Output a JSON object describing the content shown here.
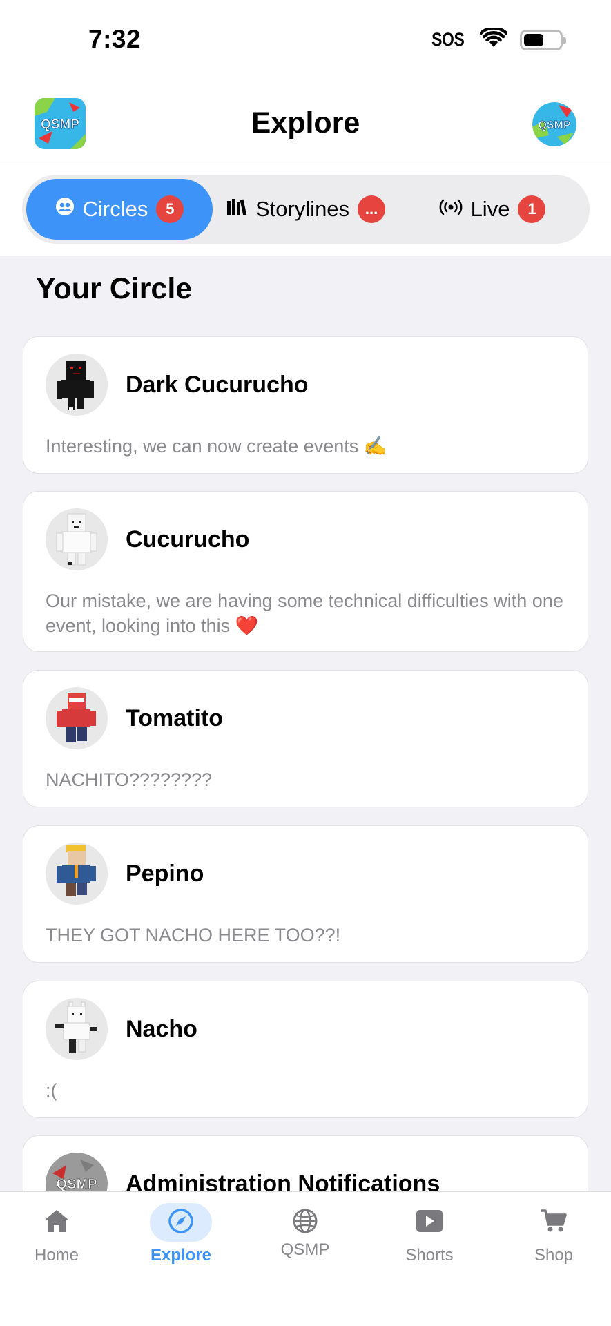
{
  "status_bar": {
    "time": "7:32",
    "sos": "SOS",
    "battery_level": 0.55
  },
  "header": {
    "title": "Explore",
    "logo_text": "QSMP",
    "avatar_text": "QSMP"
  },
  "segments": [
    {
      "label": "Circles",
      "badge": "5",
      "icon": "people-icon",
      "active": true
    },
    {
      "label": "Storylines",
      "badge": "...",
      "icon": "books-icon",
      "active": false
    },
    {
      "label": "Live",
      "badge": "1",
      "icon": "broadcast-icon",
      "active": false
    }
  ],
  "section": {
    "title": "Your Circle"
  },
  "circle": [
    {
      "name": "Dark Cucurucho",
      "message": "Interesting, we can now create events ✍️"
    },
    {
      "name": "Cucurucho",
      "message": "Our mistake, we are having some technical difficulties with one event, looking into this ❤️"
    },
    {
      "name": "Tomatito",
      "message": "NACHITO????????"
    },
    {
      "name": "Pepino",
      "message": "THEY GOT NACHO HERE TOO??!"
    },
    {
      "name": "Nacho",
      "message": ":("
    },
    {
      "name": "Administration Notifications",
      "message": "",
      "avatar_text": "QSMP"
    }
  ],
  "tabbar": {
    "items": [
      {
        "label": "Home",
        "icon": "house-icon"
      },
      {
        "label": "Explore",
        "icon": "compass-icon",
        "active": true
      },
      {
        "label": "QSMP",
        "icon": "globe-icon"
      },
      {
        "label": "Shorts",
        "icon": "play-icon"
      },
      {
        "label": "Shop",
        "icon": "cart-icon"
      }
    ]
  },
  "colors": {
    "accent": "#3d93f8",
    "badge": "#e6453f",
    "background": "#f2f2f6",
    "muted_text": "#8a8a8e"
  }
}
